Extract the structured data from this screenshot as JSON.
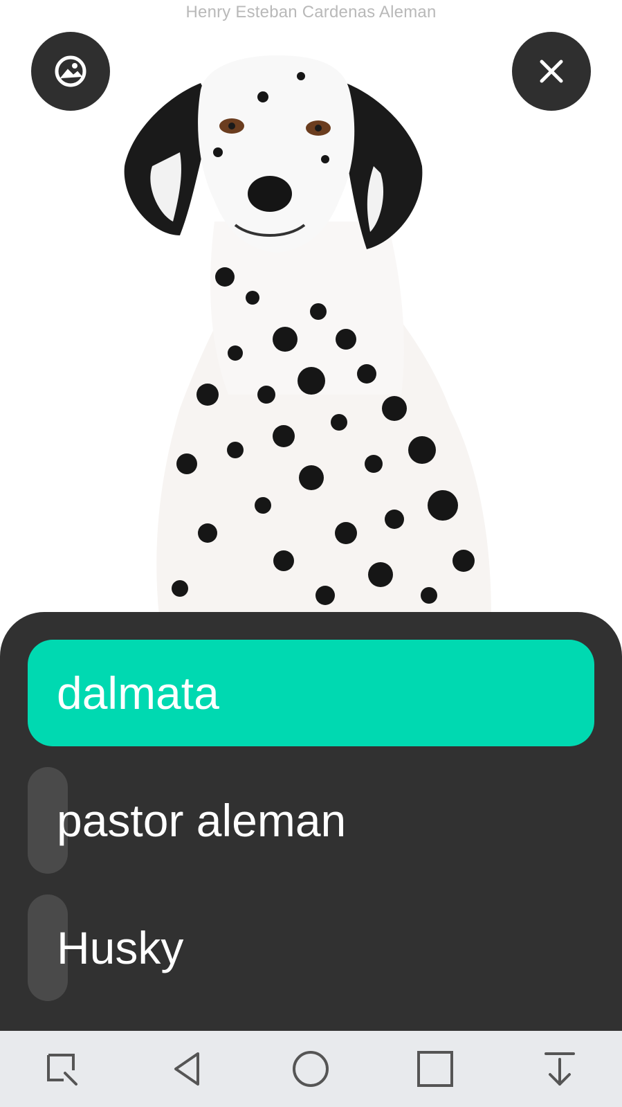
{
  "header": {
    "author": "Henry Esteban Cardenas Aleman"
  },
  "toolbar": {
    "left_icon": "image-search-icon",
    "right_icon": "close-icon"
  },
  "image": {
    "subject": "dalmatian dog photo"
  },
  "options": [
    {
      "label": "dalmata",
      "selected": true
    },
    {
      "label": "pastor aleman",
      "selected": false
    },
    {
      "label": "Husky",
      "selected": false
    }
  ],
  "colors": {
    "selected": "#00d9b1",
    "sheet": "#313131",
    "button": "#2f2f2f",
    "navbar": "#e8eaed"
  },
  "navbar": {
    "icons": [
      "screenshot-icon",
      "back-icon",
      "home-icon",
      "recents-icon",
      "notifications-down-icon"
    ]
  }
}
